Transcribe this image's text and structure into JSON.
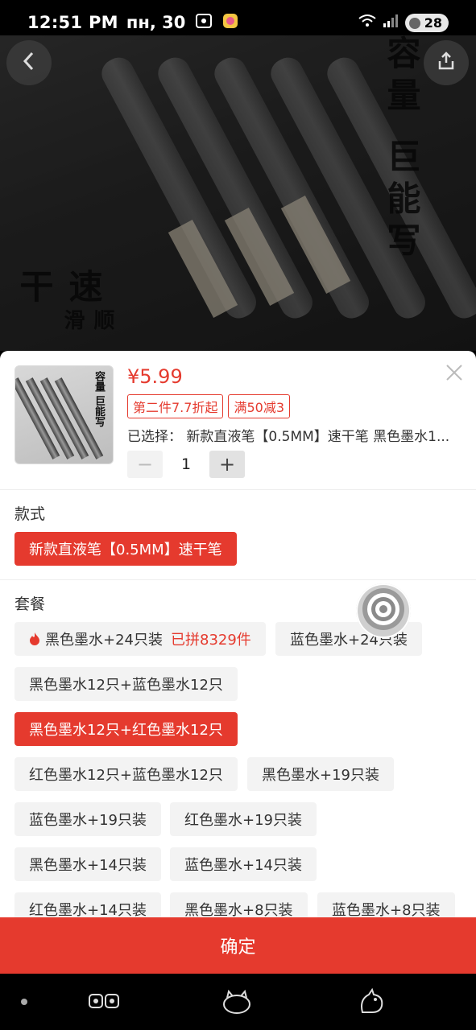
{
  "status_bar": {
    "time": "12:51 PM",
    "date": "пн, 30",
    "battery": "28",
    "network": "5G"
  },
  "hero": {
    "text_right": "容量 巨能写",
    "text_left": "速干",
    "text_left_sub": "顺滑"
  },
  "product": {
    "price": "¥5.99",
    "tags": [
      "第二件7.7折起",
      "满50减3"
    ],
    "selected_label": "已选择：",
    "selected_value": "新款直液笔【0.5MM】速干笔 黑色墨水1...",
    "quantity": "1",
    "minus": "−",
    "plus": "+"
  },
  "section_style": {
    "title": "款式",
    "options": [
      "新款直液笔【0.5MM】速干笔"
    ],
    "selected_index": 0
  },
  "section_package": {
    "title": "套餐",
    "options": [
      {
        "label": "黑色墨水+24只装",
        "hot": "已拼8329件"
      },
      {
        "label": "蓝色墨水+24只装"
      },
      {
        "label": "黑色墨水12只+蓝色墨水12只"
      },
      {
        "label": "黑色墨水12只+红色墨水12只"
      },
      {
        "label": "红色墨水12只+蓝色墨水12只"
      },
      {
        "label": "黑色墨水+19只装"
      },
      {
        "label": "蓝色墨水+19只装"
      },
      {
        "label": "红色墨水+19只装"
      },
      {
        "label": "黑色墨水+14只装"
      },
      {
        "label": "蓝色墨水+14只装"
      },
      {
        "label": "红色墨水+14只装"
      },
      {
        "label": "黑色墨水+8只装"
      },
      {
        "label": "蓝色墨水+8只装"
      }
    ],
    "selected_index": 3
  },
  "confirm_label": "确定",
  "colors": {
    "accent": "#e53a2e",
    "chip_bg": "#f3f3f3"
  }
}
